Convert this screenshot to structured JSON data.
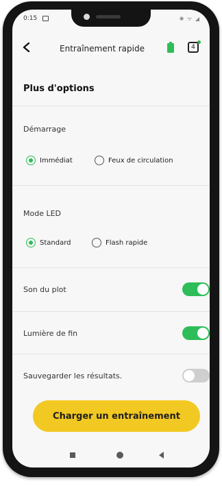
{
  "status_bar": {
    "time": "0:15",
    "right_icons": "✱ ᯤ ◢"
  },
  "app_bar": {
    "title": "Entraînement rapide",
    "counter": "4"
  },
  "section_title": "Plus d'options",
  "demarrage": {
    "label": "Démarrage",
    "options": [
      {
        "label": "Immédiat",
        "selected": true
      },
      {
        "label": "Feux de circulation",
        "selected": false
      }
    ]
  },
  "mode_led": {
    "label": "Mode LED",
    "options": [
      {
        "label": "Standard",
        "selected": true
      },
      {
        "label": "Flash rapide",
        "selected": false
      }
    ]
  },
  "toggles": [
    {
      "label": "Son du plot",
      "on": true
    },
    {
      "label": "Lumière de fin",
      "on": true
    },
    {
      "label": "Sauvegarder les résultats.",
      "on": false
    }
  ],
  "button": {
    "label": "Charger un entraînement"
  },
  "colors": {
    "accent_green": "#2ebd59",
    "button_yellow": "#f2c823"
  }
}
